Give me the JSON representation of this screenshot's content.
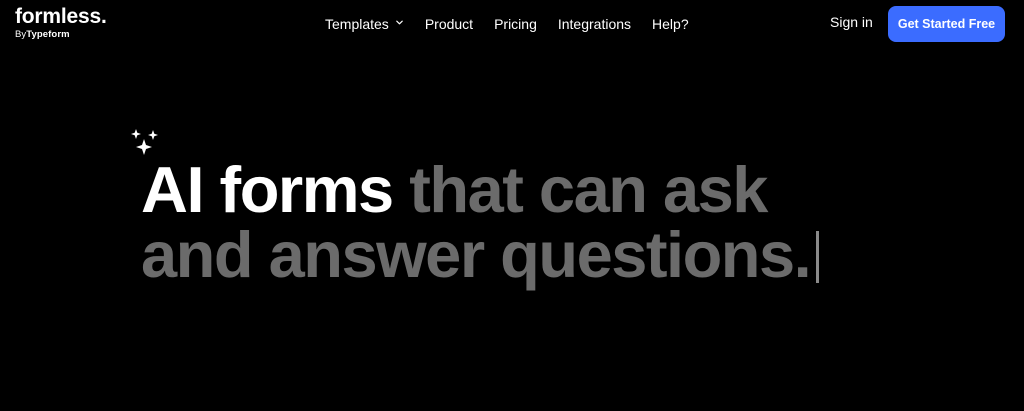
{
  "brand": {
    "name": "formless.",
    "sub_prefix": "By",
    "sub_brand": "Typeform"
  },
  "nav": {
    "items": [
      {
        "label": "Templates",
        "has_dropdown": true
      },
      {
        "label": "Product"
      },
      {
        "label": "Pricing"
      },
      {
        "label": "Integrations"
      },
      {
        "label": "Help?"
      }
    ],
    "sign_in": "Sign in",
    "cta": "Get Started Free"
  },
  "hero": {
    "line1_strong": "AI forms",
    "line1_muted": "that can ask",
    "line2_muted": "and answer questions."
  },
  "icons": {
    "sparkles": "sparkles-icon",
    "dropdown": "chevron-down-icon"
  },
  "colors": {
    "background": "#000000",
    "text": "#ffffff",
    "muted": "#6b6b6b",
    "accent": "#3b6cff"
  }
}
